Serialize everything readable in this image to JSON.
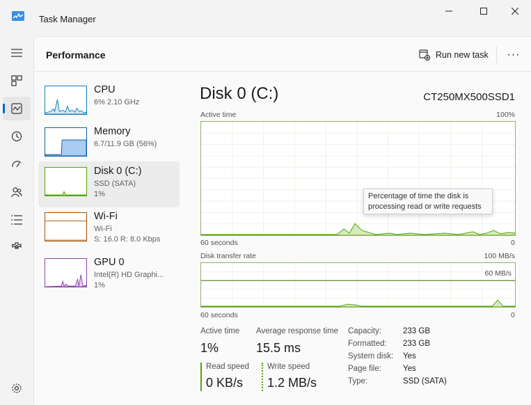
{
  "titlebar": {
    "title": "Task Manager",
    "app_icon": "task-manager-icon",
    "minimize_icon": "minimize-icon",
    "maximize_icon": "maximize-icon",
    "close_icon": "close-icon"
  },
  "nav": {
    "items": [
      {
        "icon": "hamburger-menu-icon"
      },
      {
        "icon": "processes-icon"
      },
      {
        "icon": "performance-icon",
        "active": true
      },
      {
        "icon": "app-history-icon"
      },
      {
        "icon": "startup-apps-icon"
      },
      {
        "icon": "users-icon"
      },
      {
        "icon": "details-icon"
      },
      {
        "icon": "services-icon"
      },
      {
        "icon": "settings-icon"
      }
    ]
  },
  "header": {
    "title": "Performance",
    "run_new_task": "Run new task",
    "more_label": "···"
  },
  "devices": [
    {
      "name": "CPU",
      "sub1": "6%  2.10 GHz",
      "sub2": "",
      "sub3": "",
      "color": "#117dbb"
    },
    {
      "name": "Memory",
      "sub1": "6.7/11.9 GB (56%)",
      "sub2": "",
      "sub3": "",
      "color": "#0d5fa8"
    },
    {
      "name": "Disk 0 (C:)",
      "sub1": "SSD (SATA)",
      "sub2": "1%",
      "sub3": "",
      "color": "#4da60c"
    },
    {
      "name": "Wi-Fi",
      "sub1": "Wi-Fi",
      "sub2": "S: 16.0  R: 8.0 Kbps",
      "sub3": "",
      "color": "#a74f01"
    },
    {
      "name": "GPU 0",
      "sub1": "Intel(R) HD Graphi...",
      "sub2": "1%",
      "sub3": "",
      "color": "#8e44ad"
    }
  ],
  "detail": {
    "title": "Disk 0 (C:)",
    "model": "CT250MX500SSD1",
    "active_chart": {
      "label": "Active time",
      "max_label": "100%",
      "x_left": "60 seconds",
      "x_right": "0"
    },
    "transfer_chart": {
      "label": "Disk transfer rate",
      "max_label": "100 MB/s",
      "line_label": "60 MB/s",
      "x_left": "60 seconds",
      "x_right": "0"
    },
    "tooltip": "Percentage of time the disk is processing read or write requests",
    "stats": {
      "active_time_label": "Active time",
      "active_time_value": "1%",
      "avg_response_label": "Average response time",
      "avg_response_value": "15.5 ms",
      "read_speed_label": "Read speed",
      "read_speed_value": "0 KB/s",
      "write_speed_label": "Write speed",
      "write_speed_value": "1.2 MB/s"
    },
    "properties": [
      {
        "label": "Capacity:",
        "value": "233 GB"
      },
      {
        "label": "Formatted:",
        "value": "233 GB"
      },
      {
        "label": "System disk:",
        "value": "Yes"
      },
      {
        "label": "Page file:",
        "value": "Yes"
      },
      {
        "label": "Type:",
        "value": "SSD (SATA)"
      }
    ]
  },
  "colors": {
    "disk_line": "#4da60c",
    "disk_fill": "#d7ecb8",
    "accent": "#0067c0"
  }
}
